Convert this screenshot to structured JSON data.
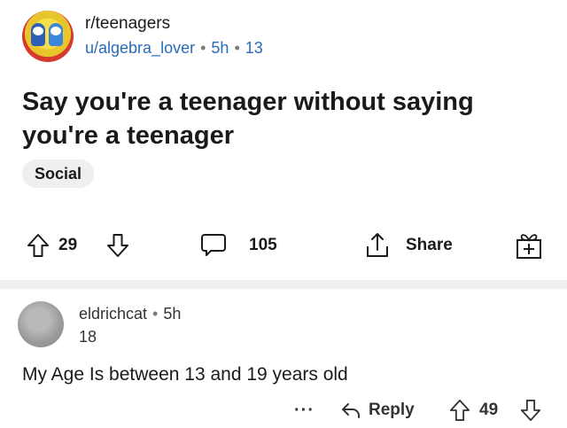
{
  "post": {
    "subreddit": "r/teenagers",
    "author": "u/algebra_lover",
    "age": "5h",
    "author_flair": "13",
    "title": "Say you're a teenager without saying you're a teenager",
    "flair": "Social",
    "votes": "29",
    "comments": "105",
    "share_label": "Share",
    "icons": [
      "upvote-icon",
      "downvote-icon",
      "comment-icon",
      "share-icon",
      "award-icon"
    ]
  },
  "comment": {
    "username": "eldrichcat",
    "age": "5h",
    "flair": "18",
    "body": "My Age Is between 13 and 19 years old",
    "more_label": "···",
    "reply_label": "Reply",
    "votes": "49",
    "icons": [
      "more-options-icon",
      "reply-icon",
      "upvote-icon",
      "downvote-icon"
    ]
  },
  "colors": {
    "meta_blue": "#2a6bb8",
    "text": "#1a1a1b",
    "divider": "#edeff1"
  }
}
